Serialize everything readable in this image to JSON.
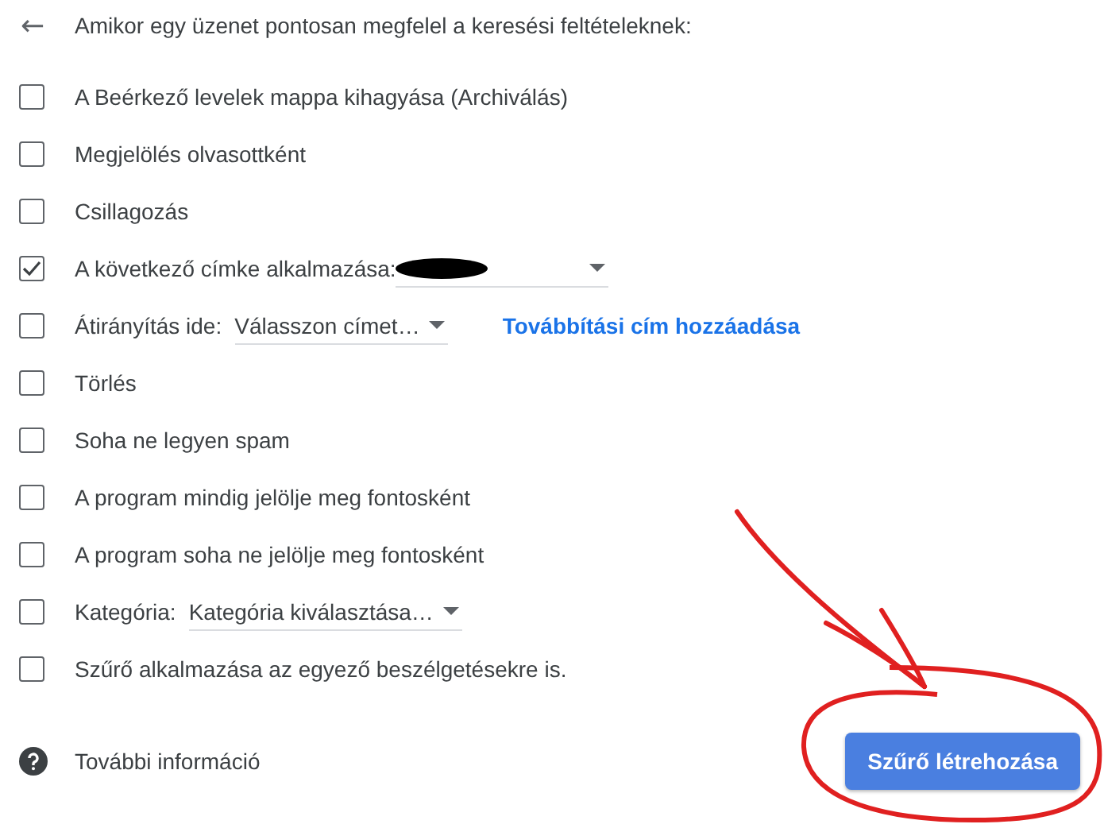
{
  "header": {
    "back": "←",
    "title": "Amikor egy üzenet pontosan megfelel a keresési feltételeknek:"
  },
  "options": [
    {
      "kind": "plain",
      "label": "A Beérkező levelek mappa kihagyása (Archiválás)",
      "checked": false
    },
    {
      "kind": "plain",
      "label": "Megjelölés olvasottként",
      "checked": false
    },
    {
      "kind": "plain",
      "label": "Csillagozás",
      "checked": false
    },
    {
      "kind": "redacted-select",
      "label": "A következő címke alkalmazása:",
      "checked": true
    },
    {
      "kind": "select-link",
      "label": "Átirányítás ide:",
      "select": "Válasszon címet…",
      "link": "Továbbítási cím hozzáadása",
      "checked": false
    },
    {
      "kind": "plain",
      "label": "Törlés",
      "checked": false
    },
    {
      "kind": "plain",
      "label": "Soha ne legyen spam",
      "checked": false
    },
    {
      "kind": "plain",
      "label": "A program mindig jelölje meg fontosként",
      "checked": false
    },
    {
      "kind": "plain",
      "label": "A program soha ne jelölje meg fontosként",
      "checked": false
    },
    {
      "kind": "select",
      "label": "Kategória:",
      "select": "Kategória kiválasztása…",
      "checked": false
    },
    {
      "kind": "plain",
      "label": "Szűrő alkalmazása az egyező beszélgetésekre is.",
      "checked": false
    }
  ],
  "footer": {
    "help": "További információ",
    "create_button": "Szűrő létrehozása"
  }
}
